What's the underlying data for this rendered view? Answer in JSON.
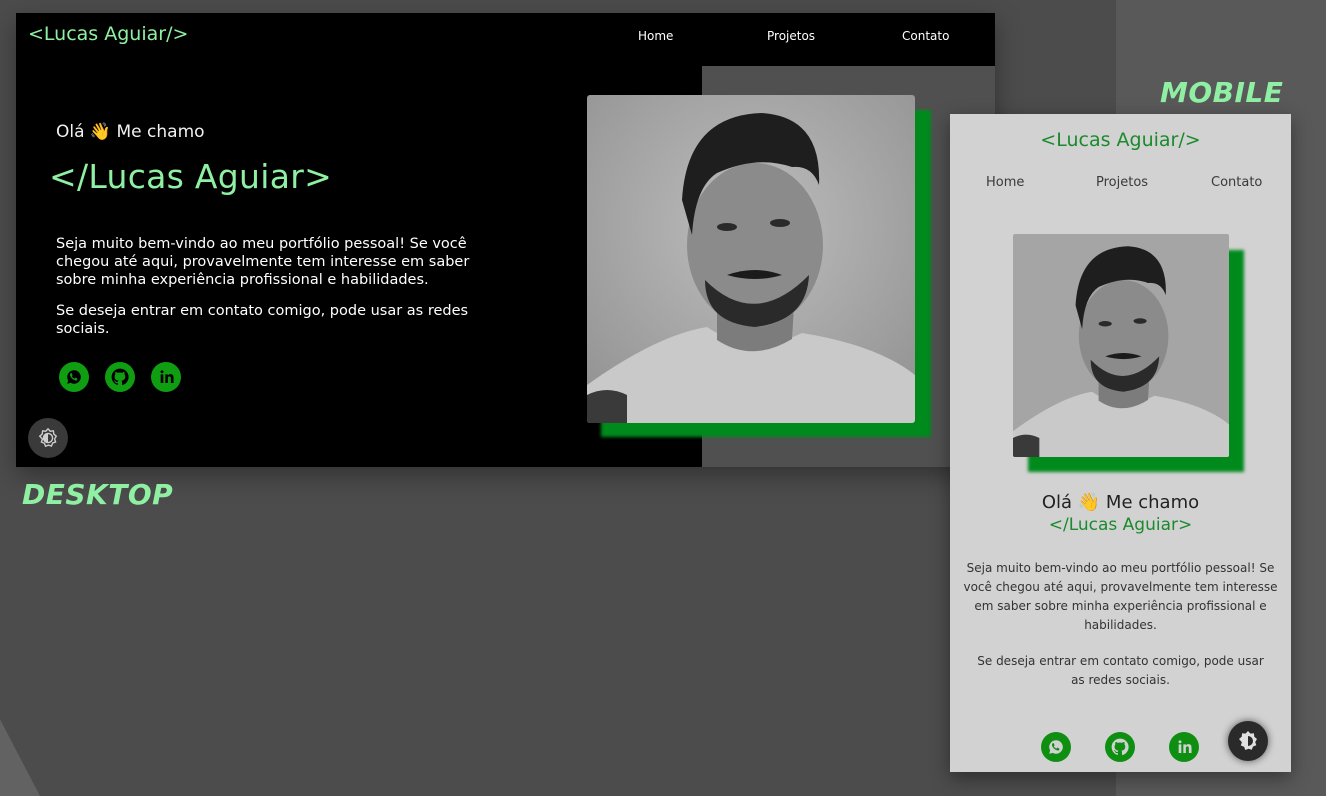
{
  "labels": {
    "mobile": "MOBILE",
    "desktop": "DESKTOP"
  },
  "desktop": {
    "logo": "<Lucas Aguiar/>",
    "nav": [
      "Home",
      "Projetos",
      "Contato"
    ],
    "greeting": "Olá 👋 Me chamo",
    "name": "</Lucas Aguiar>",
    "intro": "Seja muito bem-vindo ao meu portfólio pessoal! Se você chegou até aqui, provavelmente tem interesse em saber sobre minha experiência profissional e habilidades.",
    "contact_text": "Se deseja entrar em contato comigo, pode usar as redes sociais.",
    "social": [
      "whatsapp-icon",
      "github-icon",
      "linkedin-icon"
    ],
    "theme_toggle": "theme-toggle-icon"
  },
  "mobile": {
    "logo": "<Lucas Aguiar/>",
    "nav": [
      "Home",
      "Projetos",
      "Contato"
    ],
    "greeting": "Olá 👋 Me chamo",
    "name": "</Lucas Aguiar>",
    "intro": "Seja muito bem-vindo ao meu portfólio pessoal! Se você chegou até aqui, provavelmente tem interesse em saber sobre minha experiência profissional e habilidades.",
    "contact_text": "Se deseja entrar em contato comigo, pode usar as redes sociais.",
    "social": [
      "whatsapp-icon",
      "github-icon",
      "linkedin-icon"
    ],
    "theme_toggle": "theme-toggle-icon"
  },
  "colors": {
    "accent_green": "#8ff0a4",
    "brand_green": "#0f9d12",
    "shadow_green": "#008a1c"
  }
}
